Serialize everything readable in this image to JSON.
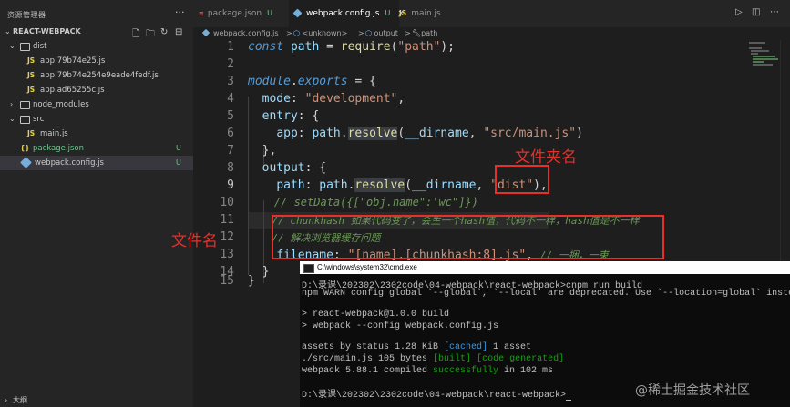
{
  "explorer": {
    "title": "资源管理器",
    "more": "···",
    "project": "REACT-WEBPACK",
    "tree": [
      {
        "label": "dist",
        "kind": "folder-open"
      },
      {
        "label": "app.79b74e25.js",
        "kind": "js"
      },
      {
        "label": "app.79b74e254e9eade4fedf.js",
        "kind": "js"
      },
      {
        "label": "app.ad65255c.js",
        "kind": "js"
      },
      {
        "label": "node_modules",
        "kind": "folder-closed"
      },
      {
        "label": "src",
        "kind": "folder-open"
      },
      {
        "label": "main.js",
        "kind": "js"
      },
      {
        "label": "package.json",
        "kind": "json",
        "status": "U"
      },
      {
        "label": "webpack.config.js",
        "kind": "webpack",
        "status": "U"
      }
    ],
    "outline": "大纲"
  },
  "tabs": [
    {
      "label": "package.json",
      "status": "U"
    },
    {
      "label": "webpack.config.js",
      "status": "U",
      "close": "×"
    },
    {
      "label": "main.js"
    }
  ],
  "breadcrumb": {
    "file": "webpack.config.js",
    "sep": ">",
    "scope": "<unknown>",
    "output": "output",
    "path": "path"
  },
  "code": {
    "line_numbers": [
      "1",
      "2",
      "3",
      "4",
      "5",
      "6",
      "7",
      "8",
      "9",
      "10",
      "11",
      "12",
      "13",
      "14",
      "15"
    ],
    "l1_kw": "const",
    "l1_var": "path",
    "l1_eq": " = ",
    "l1_fn": "require",
    "l1_p1": "(",
    "l1_str": "\"path\"",
    "l1_p2": ");",
    "l3_obj": "module",
    "l3_dot": ".",
    "l3_prop": "exports",
    "l3_rest": " = {",
    "l4_key": "mode",
    "l4_colon": ": ",
    "l4_str": "\"development\"",
    "l4_comma": ",",
    "l5_key": "entry",
    "l5_rest": ": {",
    "l6_key": "app",
    "l6_colon": ": ",
    "l6_obj": "path",
    "l6_dot": ".",
    "l6_fn": "resolve",
    "l6_p1": "(",
    "l6_var": "__dirname",
    "l6_comma": ", ",
    "l6_str": "\"src/main.js\"",
    "l6_p2": ")",
    "l7": "},",
    "l8_key": "output",
    "l8_rest": ": {",
    "l9_key": "path",
    "l9_colon": ": ",
    "l9_obj": "path",
    "l9_dot": ".",
    "l9_fn": "resolve",
    "l9_p1": "(",
    "l9_var": "__dirname",
    "l9_comma": ", ",
    "l9_str": "\"dist\"",
    "l9_p2": "),",
    "l10": "// setData({[\"obj.name\":'wc\"]})",
    "l11": "// chunkhash 如果代码变了，会生一个hash值，代码不一样，hash值是不一样",
    "l12": "// 解决浏览器缓存问题",
    "l13_key": "filename",
    "l13_colon": ": ",
    "l13_str": "\"[name].[chunkhash:8].js\"",
    "l13_comma": ", ",
    "l13_com": "// 一捆，一束",
    "l14": "}",
    "l15": "}"
  },
  "annotations": {
    "folder_name": "文件夹名",
    "file_name": "文件名"
  },
  "cmd": {
    "title": "C:\\windows\\system32\\cmd.exe",
    "lines": {
      "l1": "D:\\录课\\202302\\2302code\\04-webpack\\react-webpack>cnpm run build",
      "l2": "npm WARN config global `--global`, `--local` are deprecated. Use `--location=global` instead.",
      "l3": "> react-webpack@1.0.0 build",
      "l4": "> webpack --config webpack.config.js",
      "l5_a": "assets by status 1.28 KiB ",
      "l5_b": "[cached]",
      "l5_c": " 1 asset",
      "l6_a": "./src/main.js 105 bytes ",
      "l6_b": "[built]",
      "l6_c": " ",
      "l6_d": "[code generated]",
      "l7_a": "webpack 5.88.1 compiled ",
      "l7_b": "successfully",
      "l7_c": " in 102 ms",
      "l8": "D:\\录课\\202302\\2302code\\04-webpack\\react-webpack>"
    }
  },
  "watermark": "@稀土掘金技术社区",
  "colors": {
    "annotation_red": "#e8302a",
    "editor_bg": "#1e1e1e",
    "sidebar_bg": "#252526"
  }
}
